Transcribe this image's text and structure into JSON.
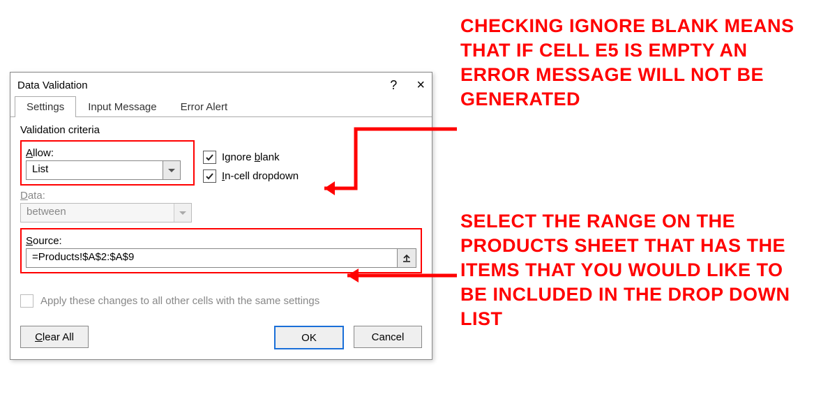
{
  "dialog": {
    "title": "Data Validation",
    "help_symbol": "?",
    "close_symbol": "×",
    "tabs": {
      "settings": "Settings",
      "input_message": "Input Message",
      "error_alert": "Error Alert"
    },
    "section": "Validation criteria",
    "allow_label": "Allow:",
    "allow_value": "List",
    "data_label": "Data:",
    "data_value": "between",
    "ignore_blank_label_pre": "Ignore ",
    "ignore_blank_label_u": "b",
    "ignore_blank_label_post": "lank",
    "incell_label_pre": "",
    "incell_label_u": "I",
    "incell_label_post": "n-cell dropdown",
    "source_label": "Source:",
    "source_value": "=Products!$A$2:$A$9",
    "apply_label": "Apply these changes to all other cells with the same settings",
    "buttons": {
      "clear_all": "Clear All",
      "ok": "OK",
      "cancel": "Cancel"
    }
  },
  "callouts": {
    "c1": "CHECKING IGNORE BLANK MEANS THAT IF CELL E5 IS EMPTY AN ERROR MESSAGE WILL NOT BE GENERATED",
    "c2": "SELECT THE RANGE ON THE PRODUCTS SHEET THAT HAS THE ITEMS THAT YOU WOULD LIKE TO BE INCLUDED IN THE DROP DOWN LIST"
  }
}
